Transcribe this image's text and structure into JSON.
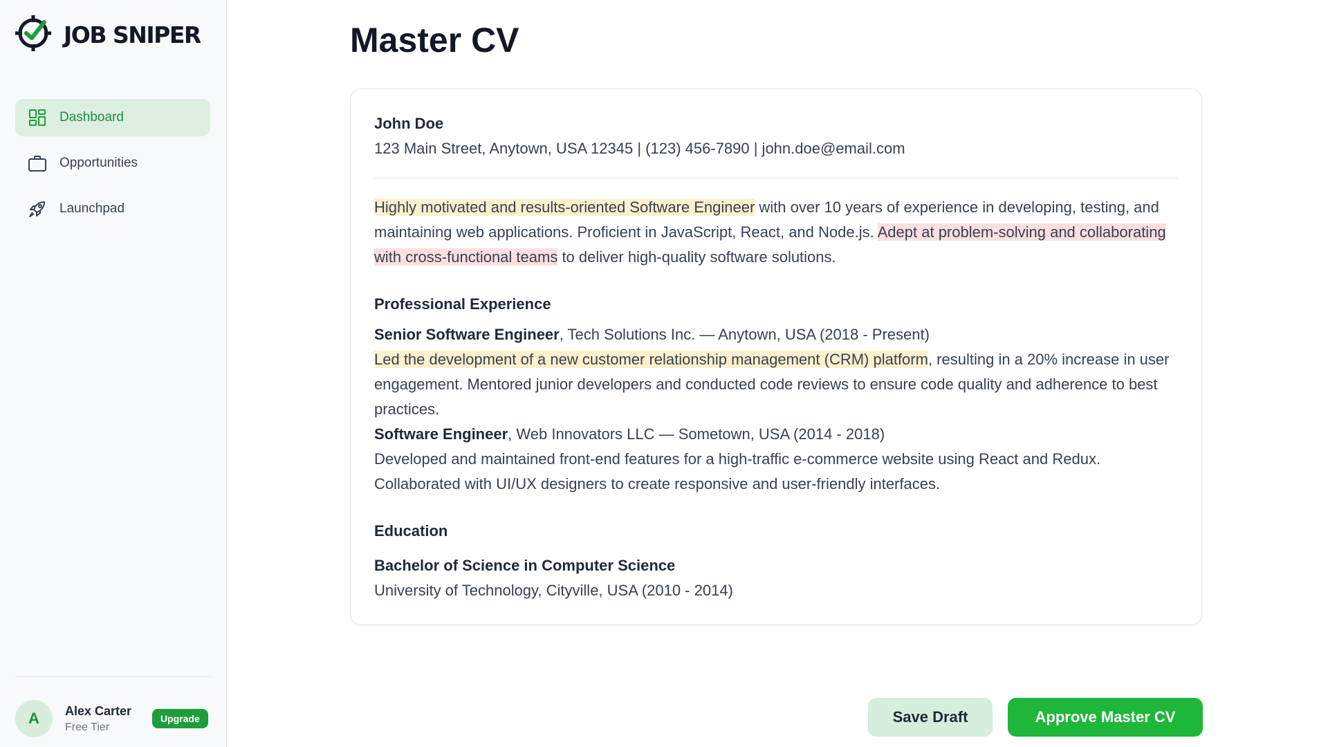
{
  "brand": {
    "name": "JOB SNIPER",
    "accent": "#1e9e3b"
  },
  "sidebar": {
    "items": [
      {
        "label": "Dashboard",
        "icon": "dashboard-grid-icon",
        "active": true
      },
      {
        "label": "Opportunities",
        "icon": "briefcase-icon",
        "active": false
      },
      {
        "label": "Launchpad",
        "icon": "rocket-icon",
        "active": false
      }
    ],
    "user": {
      "initial": "A",
      "name": "Alex Carter",
      "tier": "Free Tier",
      "upgrade_label": "Upgrade"
    }
  },
  "main": {
    "title": "Master CV",
    "cv": {
      "name": "John Doe",
      "contact": "123 Main Street, Anytown, USA 12345 | (123) 456-7890 | john.doe@email.com",
      "summary": {
        "hl1": "Highly motivated and results-oriented Software Engineer",
        "text1": " with over 10 years of experience in developing, testing, and maintaining web applications. Proficient in JavaScript, React, and Node.js. ",
        "hl2": "Adept at problem-solving and collaborating with cross-functional teams",
        "text2": " to deliver high-quality software solutions."
      },
      "experience_title": "Professional Experience",
      "jobs": [
        {
          "role": "Senior Software Engineer",
          "org": ", Tech Solutions Inc. — Anytown, USA (2018 - Present)",
          "highlight": "Led the development of a new customer relationship management (CRM) platform",
          "desc": ", resulting in a 20% increase in user engagement. Mentored junior developers and conducted code reviews to ensure code quality and adherence to best practices."
        },
        {
          "role": "Software Engineer",
          "org": ", Web Innovators LLC — Sometown, USA (2014 - 2018)",
          "desc": "Developed and maintained front-end features for a high-traffic e-commerce website using React and Redux. Collaborated with UI/UX designers to create responsive and user-friendly interfaces."
        }
      ],
      "education_title": "Education",
      "degree": "Bachelor of Science in Computer Science",
      "school": "University of Technology, Cityville, USA (2010 - 2014)"
    },
    "actions": {
      "save_label": "Save Draft",
      "approve_label": "Approve Master CV"
    }
  }
}
